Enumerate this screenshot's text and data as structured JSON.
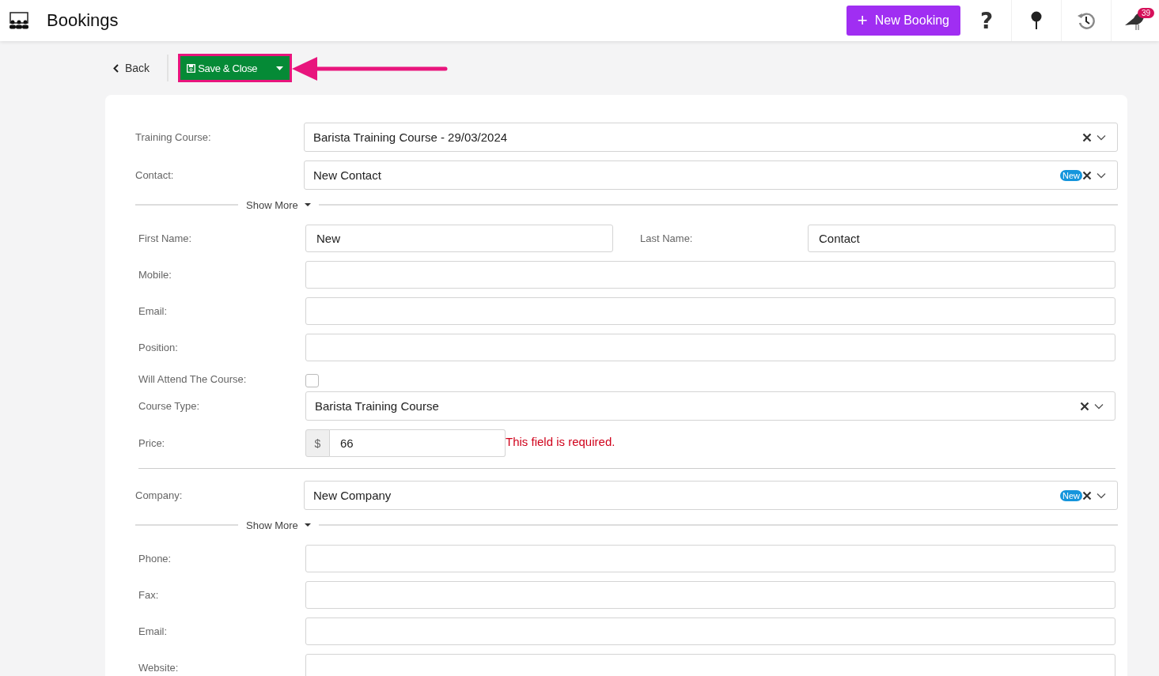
{
  "header": {
    "title": "Bookings",
    "new_button": {
      "plus": "+",
      "label": "New Booking"
    },
    "help": "?",
    "notification_count": "39"
  },
  "toolbar": {
    "back": "Back",
    "save": "Save & Close"
  },
  "rows": [
    {
      "kind": "select",
      "label": "Training Course:",
      "value": "Barista Training Course - 29/03/2024"
    },
    {
      "kind": "select",
      "label": "Contact:",
      "value": "New Contact",
      "badge": "New"
    },
    {
      "kind": "show_more",
      "label": "Show More"
    },
    {
      "kind": "pair",
      "label": "First Name:",
      "value": "New",
      "label_2": "Last Name:",
      "value_2": "Contact"
    },
    {
      "kind": "text",
      "label": "Mobile:"
    },
    {
      "kind": "text",
      "label": "Email:"
    },
    {
      "kind": "text",
      "label": "Position:"
    },
    {
      "kind": "checkbox",
      "label": "Will Attend The Course:",
      "checked": false
    },
    {
      "kind": "detail_select",
      "label": "Course Type:",
      "value": "Barista Training Course"
    },
    {
      "kind": "money",
      "label": "Price:",
      "currency": "$",
      "value": "66",
      "error": "This field is required."
    },
    {
      "kind": "rule"
    },
    {
      "kind": "select",
      "label": "Company:",
      "value": "New Company",
      "badge": "New"
    },
    {
      "kind": "show_more",
      "label": "Show More"
    },
    {
      "kind": "text",
      "label": "Phone:"
    },
    {
      "kind": "text",
      "label": "Fax:"
    },
    {
      "kind": "text",
      "label": "Email:"
    },
    {
      "kind": "text",
      "label": "Website:"
    }
  ]
}
